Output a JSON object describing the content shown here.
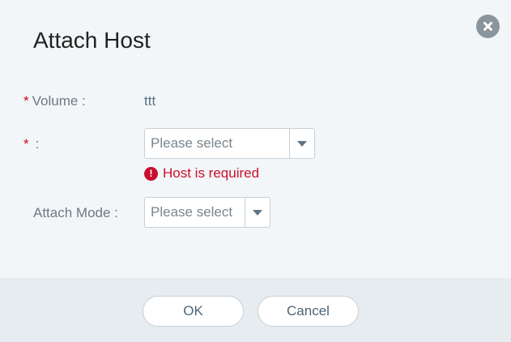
{
  "dialog": {
    "title": "Attach Host",
    "close_icon": "close-icon"
  },
  "form": {
    "volume": {
      "required_mark": "*",
      "label": "Volume :",
      "value": "ttt"
    },
    "host": {
      "required_mark": "*",
      "label": ":",
      "placeholder": "Please select",
      "error_icon": "exclamation-circle-icon",
      "error_text": "Host is required"
    },
    "attach_mode": {
      "label": "Attach Mode :",
      "placeholder": "Please select"
    }
  },
  "footer": {
    "ok_label": "OK",
    "cancel_label": "Cancel"
  },
  "colors": {
    "required": "#d0021b",
    "error": "#c8102e",
    "background": "#f3f6f8",
    "footer_background": "#e6ecef"
  }
}
